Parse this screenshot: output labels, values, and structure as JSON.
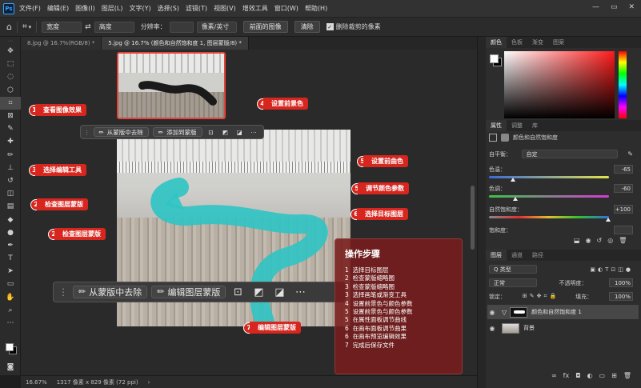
{
  "app": {
    "logo": "Ps",
    "menu": [
      "文件(F)",
      "编辑(E)",
      "图像(I)",
      "图层(L)",
      "文字(Y)",
      "选择(S)",
      "滤镜(T)",
      "视图(V)",
      "增效工具",
      "窗口(W)",
      "帮助(H)"
    ],
    "window_controls": [
      "—",
      "▭",
      "✕"
    ]
  },
  "options_bar": {
    "width_label": "宽度",
    "height_label": "高度",
    "resolution_label": "分辨率：",
    "unit": "像素/英寸",
    "front_image_button": "前面的图像",
    "clear_button": "清除",
    "delete_cropped_label": "删除裁剪的像素"
  },
  "doc_tabs": [
    {
      "label": "8.jpg @ 16.7%(RGB/8) *",
      "active": false
    },
    {
      "label": "5.jpg @ 16.7% (颜色和自然饱和度 1, 图层蒙版/8) *",
      "active": true
    }
  ],
  "canvas": {
    "context_bar_small": {
      "remove_from_mask": "从蒙版中去除",
      "add_mask": "添加到蒙版"
    },
    "context_bar_large": {
      "remove_from_mask": "从蒙版中去除",
      "edit_mask": "编辑图层蒙版"
    },
    "callouts": [
      {
        "num": "1",
        "label": "查看图像效果"
      },
      {
        "num": "4",
        "label": "设置前景色"
      },
      {
        "num": "5",
        "label": "设置前曲色"
      },
      {
        "num": "3",
        "label": "选择编辑工具"
      },
      {
        "num": "5",
        "label": "调节颜色参数"
      },
      {
        "num": "2",
        "label": "检查图层蒙版"
      },
      {
        "num": "6",
        "label": "选择目标图层"
      },
      {
        "num": "2",
        "label": "检查图层蒙版"
      },
      {
        "num": "7",
        "label": "编辑图层蒙版"
      }
    ],
    "steps": {
      "title": "操作步骤",
      "items": [
        {
          "num": "1",
          "text": "选择目标图层"
        },
        {
          "num": "2",
          "text": "检查蒙版缩略图"
        },
        {
          "num": "3",
          "text": "检查蒙版缩略图"
        },
        {
          "num": "3",
          "text": "选择画笔或渐变工具"
        },
        {
          "num": "4",
          "text": "设置前景色与颜色参数"
        },
        {
          "num": "5",
          "text": "设置前景色与颜色参数"
        },
        {
          "num": "5",
          "text": "在属性面板调节曲线"
        },
        {
          "num": "6",
          "text": "在画布面板调节曲果"
        },
        {
          "num": "6",
          "text": "在画布预览编辑效果"
        },
        {
          "num": "7",
          "text": "完成后保存文件"
        }
      ]
    }
  },
  "status_bar": {
    "zoom": "16.67%",
    "size": "1317 像素 x 829 像素 (72 ppi)"
  },
  "color_panel": {
    "tabs": [
      "颜色",
      "色板",
      "渐变",
      "图案"
    ]
  },
  "properties_panel": {
    "tabs": [
      "属性",
      "调整",
      "库"
    ],
    "title": "颜色和自然饱和度",
    "preset_label": "自平衡：",
    "preset_value": "自定",
    "rows": [
      {
        "label": "色温：",
        "value": "-65"
      },
      {
        "label": "色调：",
        "value": "-60"
      },
      {
        "label": "自然饱和度：",
        "value": "+100"
      },
      {
        "label": "饱和度：",
        "value": ""
      }
    ]
  },
  "layers_panel": {
    "tabs": [
      "图层",
      "通道",
      "路径"
    ],
    "filter_label": "Q 类型",
    "blend_mode": "正常",
    "opacity_label": "不透明度：",
    "opacity_value": "100%",
    "lock_label": "锁定：",
    "fill_label": "填充：",
    "fill_value": "100%",
    "layers": [
      {
        "name": "颜色和自然饱和度 1"
      },
      {
        "name": "背景"
      }
    ]
  },
  "colors": {
    "accent_red": "#d7261e",
    "steps_panel": "#7a1c1c",
    "teal_brush": "#2ec4c4"
  }
}
